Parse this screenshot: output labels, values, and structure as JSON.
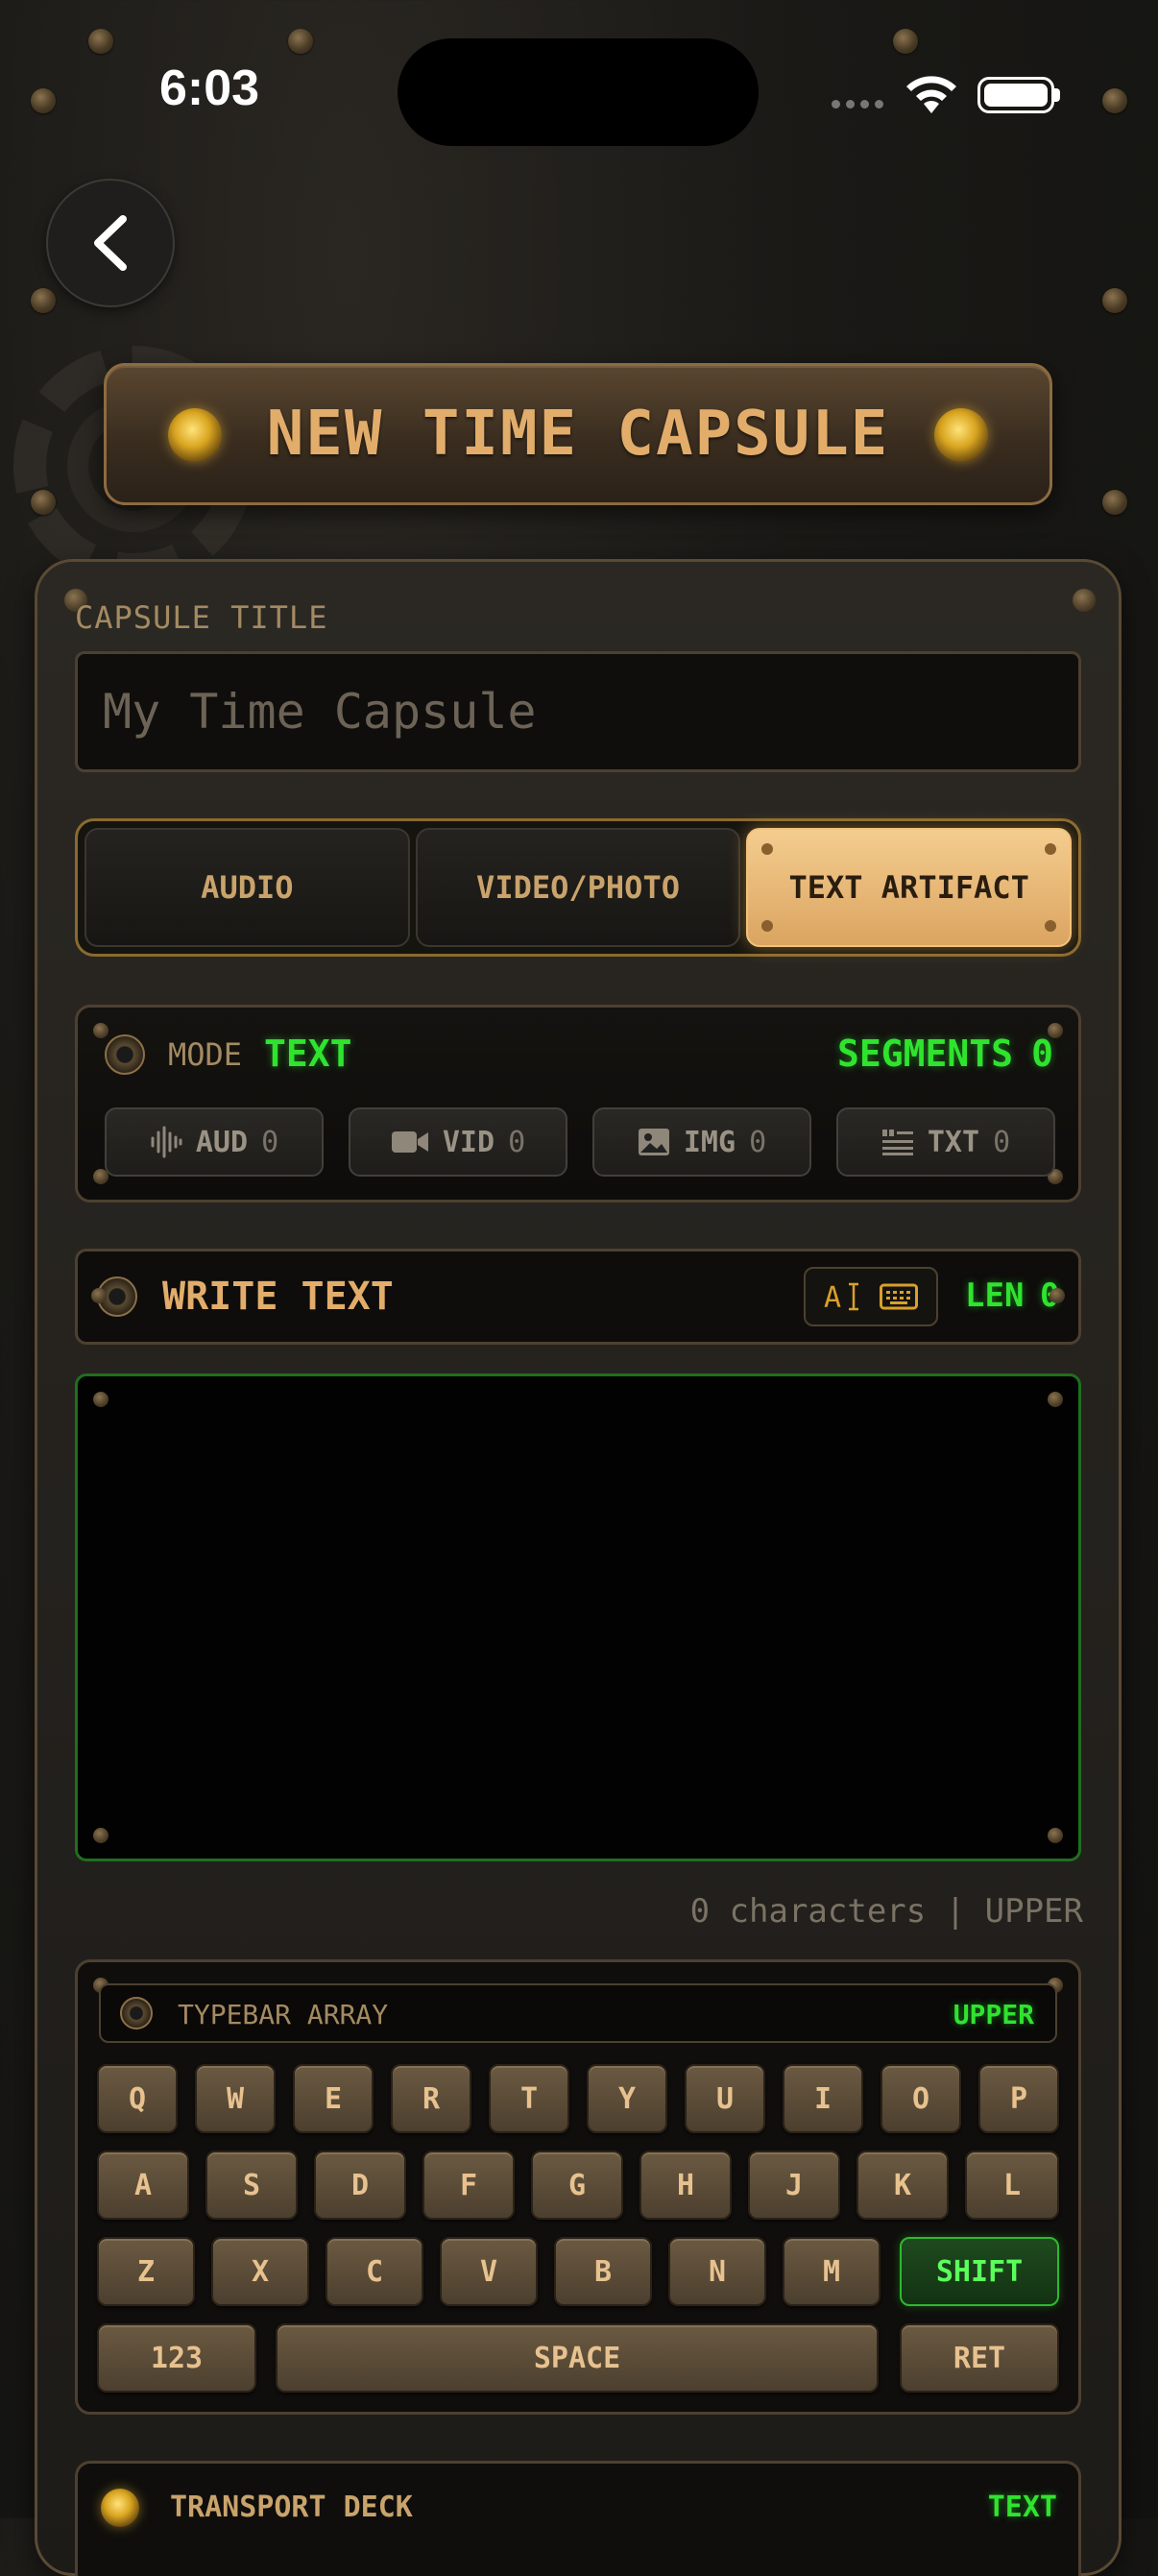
{
  "status_bar": {
    "time": "6:03"
  },
  "header": {
    "title": "NEW TIME CAPSULE"
  },
  "capsule_title": {
    "label": "CAPSULE TITLE",
    "placeholder": "My Time Capsule",
    "value": ""
  },
  "tabs": [
    {
      "label": "AUDIO",
      "active": false
    },
    {
      "label": "VIDEO/PHOTO",
      "active": false
    },
    {
      "label": "TEXT ARTIFACT",
      "active": true
    }
  ],
  "mode_panel": {
    "mode_label": "MODE",
    "mode_value": "TEXT",
    "segments_label": "SEGMENTS",
    "segments_value": "0",
    "counters": [
      {
        "icon": "waveform-icon",
        "label": "AUD",
        "count": "0"
      },
      {
        "icon": "video-camera-icon",
        "label": "VID",
        "count": "0"
      },
      {
        "icon": "image-icon",
        "label": "IMG",
        "count": "0"
      },
      {
        "icon": "quote-text-icon",
        "label": "TXT",
        "count": "0"
      }
    ]
  },
  "write_panel": {
    "title": "WRITE TEXT",
    "len_label": "LEN",
    "len_value": "0",
    "text": ""
  },
  "char_count": "0 characters | UPPER",
  "keyboard": {
    "title": "TYPEBAR ARRAY",
    "case_indicator": "UPPER",
    "row1": [
      "Q",
      "W",
      "E",
      "R",
      "T",
      "Y",
      "U",
      "I",
      "O",
      "P"
    ],
    "row2": [
      "A",
      "S",
      "D",
      "F",
      "G",
      "H",
      "J",
      "K",
      "L"
    ],
    "row3": [
      "Z",
      "X",
      "C",
      "V",
      "B",
      "N",
      "M"
    ],
    "shift_label": "SHIFT",
    "numbers_label": "123",
    "space_label": "SPACE",
    "return_label": "RET"
  },
  "transport": {
    "title": "TRANSPORT DECK",
    "mode": "TEXT"
  },
  "colors": {
    "accent_brass": "#c9a36b",
    "active_tab": "#e8b877",
    "led_green": "#2fe32f",
    "background": "#1a1916"
  }
}
